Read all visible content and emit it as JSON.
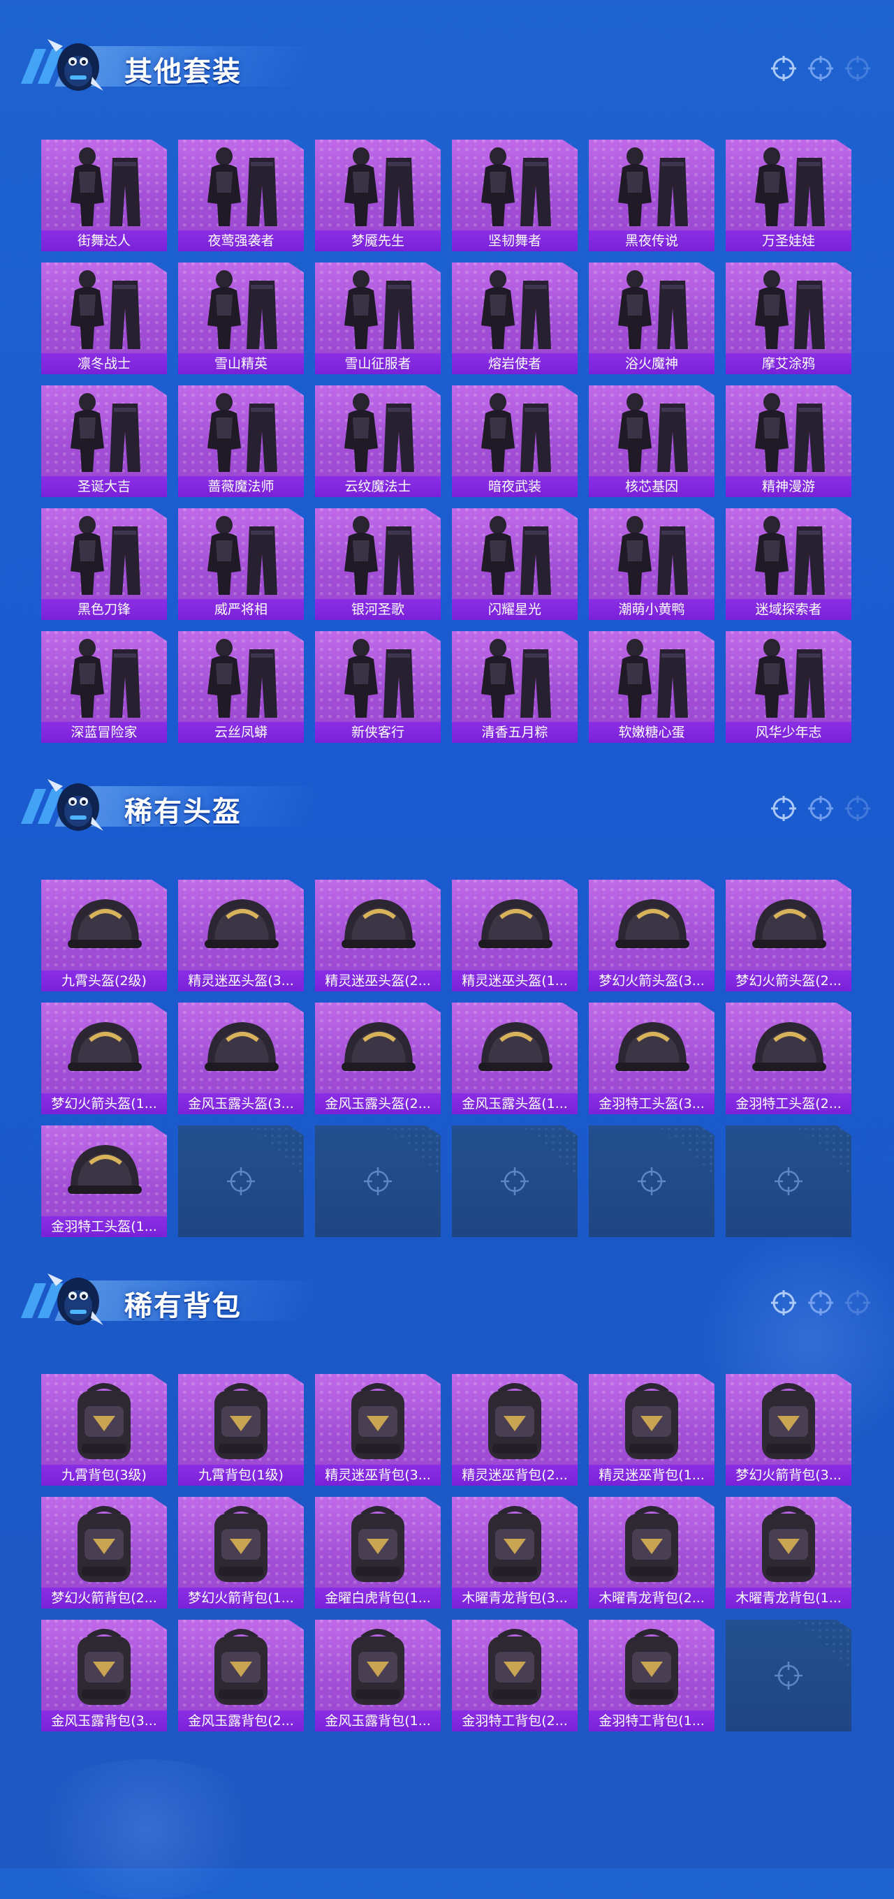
{
  "sections": [
    {
      "title": "其他套装",
      "items": [
        "街舞达人",
        "夜莺强袭者",
        "梦魇先生",
        "坚韧舞者",
        "黑夜传说",
        "万圣娃娃",
        "凛冬战士",
        "雪山精英",
        "雪山征服者",
        "熔岩使者",
        "浴火魔神",
        "摩艾涂鸦",
        "圣诞大吉",
        "蔷薇魔法师",
        "云纹魔法士",
        "暗夜武装",
        "核芯基因",
        "精神漫游",
        "黑色刀锋",
        "威严将相",
        "银河圣歌",
        "闪耀星光",
        "潮萌小黄鸭",
        "迷域探索者",
        "深蓝冒险家",
        "云丝凤蟒",
        "新侠客行",
        "清香五月粽",
        "软嫩糖心蛋",
        "风华少年志"
      ]
    },
    {
      "title": "稀有头盔",
      "items": [
        "九霄头盔(2级)",
        "精灵迷巫头盔(3...",
        "精灵迷巫头盔(2...",
        "精灵迷巫头盔(1...",
        "梦幻火箭头盔(3...",
        "梦幻火箭头盔(2...",
        "梦幻火箭头盔(1...",
        "金风玉露头盔(3...",
        "金风玉露头盔(2...",
        "金风玉露头盔(1...",
        "金羽特工头盔(3...",
        "金羽特工头盔(2...",
        "金羽特工头盔(1..."
      ]
    },
    {
      "title": "稀有背包",
      "items": [
        "九霄背包(3级)",
        "九霄背包(1级)",
        "精灵迷巫背包(3...",
        "精灵迷巫背包(2...",
        "精灵迷巫背包(1...",
        "梦幻火箭背包(3...",
        "梦幻火箭背包(2...",
        "梦幻火箭背包(1...",
        "金曜白虎背包(1...",
        "木曜青龙背包(3...",
        "木曜青龙背包(2...",
        "木曜青龙背包(1...",
        "金风玉露背包(3...",
        "金风玉露背包(2...",
        "金风玉露背包(1...",
        "金羽特工背包(2...",
        "金羽特工背包(1..."
      ]
    }
  ],
  "icons": {
    "section_mascot": "mascot-icon",
    "target": "crosshair-target-icon",
    "empty_slot": "crosshair-target-icon"
  },
  "colors": {
    "background": "#1c5bcc",
    "card_purple": "#a24fd6",
    "label_purple": "#7a21d8",
    "empty_slot": "#234f8e",
    "title_text": "#ffffff"
  }
}
